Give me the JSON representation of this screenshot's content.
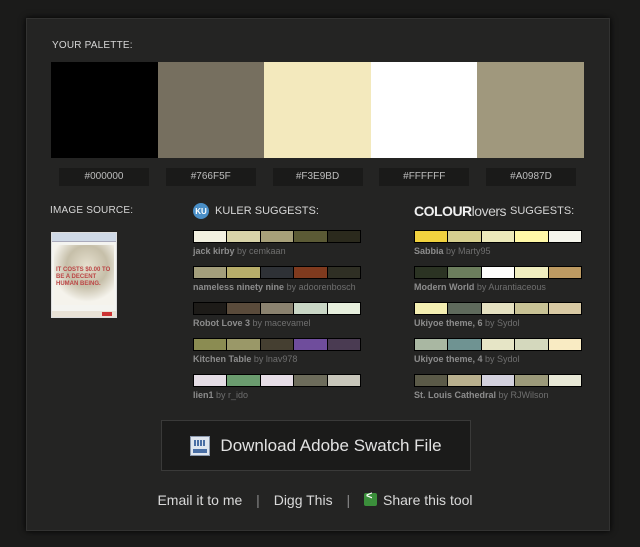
{
  "palette": {
    "label": "YOUR PALETTE:",
    "swatches": [
      {
        "hex": "#000000",
        "label": "#000000"
      },
      {
        "hex": "#766F5F",
        "label": "#766F5F"
      },
      {
        "hex": "#F3E9BD",
        "label": "#F3E9BD"
      },
      {
        "hex": "#FFFFFF",
        "label": "#FFFFFF"
      },
      {
        "hex": "#A0987D",
        "label": "#A0987D"
      }
    ]
  },
  "image_source": {
    "label": "IMAGE SOURCE:",
    "thumb_text": "IT COSTS $0.00 TO BE A DECENT HUMAN BEING."
  },
  "kuler": {
    "logo_text": "ku",
    "label": "KULER SUGGESTS:",
    "themes": [
      {
        "name": "jack kirby",
        "by": "by cemkaan",
        "colors": [
          "#f2f0e0",
          "#d8d3a8",
          "#a7a079",
          "#5b5a35",
          "#2b2a1d"
        ]
      },
      {
        "name": "nameless ninety nine",
        "by": "by adoorenbosch",
        "colors": [
          "#a39e7b",
          "#b7ad6a",
          "#2e3136",
          "#7f3a1e",
          "#2f2f24"
        ]
      },
      {
        "name": "Robot Love 3",
        "by": "by macevamel",
        "colors": [
          "#1d1b18",
          "#5a4b3b",
          "#8a826f",
          "#c9d6c5",
          "#e6eedc"
        ]
      },
      {
        "name": "Kitchen Table",
        "by": "by lnav978",
        "colors": [
          "#8b8c52",
          "#9a9868",
          "#453f31",
          "#6f4d9c",
          "#4a3b52"
        ]
      },
      {
        "name": "lien1",
        "by": "by r_ido",
        "colors": [
          "#e4dce4",
          "#6b9c6f",
          "#e6dde6",
          "#6d6c5b",
          "#c8c6ba"
        ]
      }
    ]
  },
  "colourlovers": {
    "logo_bold": "COLOUR",
    "logo_light": "lovers",
    "label": "SUGGESTS:",
    "themes": [
      {
        "name": "Sabbia",
        "by": "by Marty95",
        "colors": [
          "#f1d23f",
          "#d6cf8f",
          "#ece9ba",
          "#fff8a7",
          "#f5f5ec"
        ]
      },
      {
        "name": "Modern World",
        "by": "by Aurantiaceous",
        "colors": [
          "#2b3323",
          "#6c7e5d",
          "#fdfdfb",
          "#efedbf",
          "#bd9a62"
        ]
      },
      {
        "name": "Ukiyoe theme, 6",
        "by": "by Sydol",
        "colors": [
          "#f4efb2",
          "#5f6a5c",
          "#e4e0c0",
          "#c8c295",
          "#d8c9a3"
        ]
      },
      {
        "name": "Ukiyoe theme, 4",
        "by": "by Sydol",
        "colors": [
          "#a9b7a2",
          "#6f9392",
          "#e6e5c6",
          "#d4d8bd",
          "#f9ebc3"
        ]
      },
      {
        "name": "St. Louis Cathedral",
        "by": "by RJWilson",
        "colors": [
          "#5b5a48",
          "#b9b08e",
          "#d3d1dd",
          "#9c9a7a",
          "#e8e8d6"
        ]
      }
    ]
  },
  "download": {
    "label": "Download Adobe Swatch File"
  },
  "footer": {
    "email": "Email it to me",
    "digg": "Digg This",
    "share": "Share this tool",
    "sep": "|"
  }
}
